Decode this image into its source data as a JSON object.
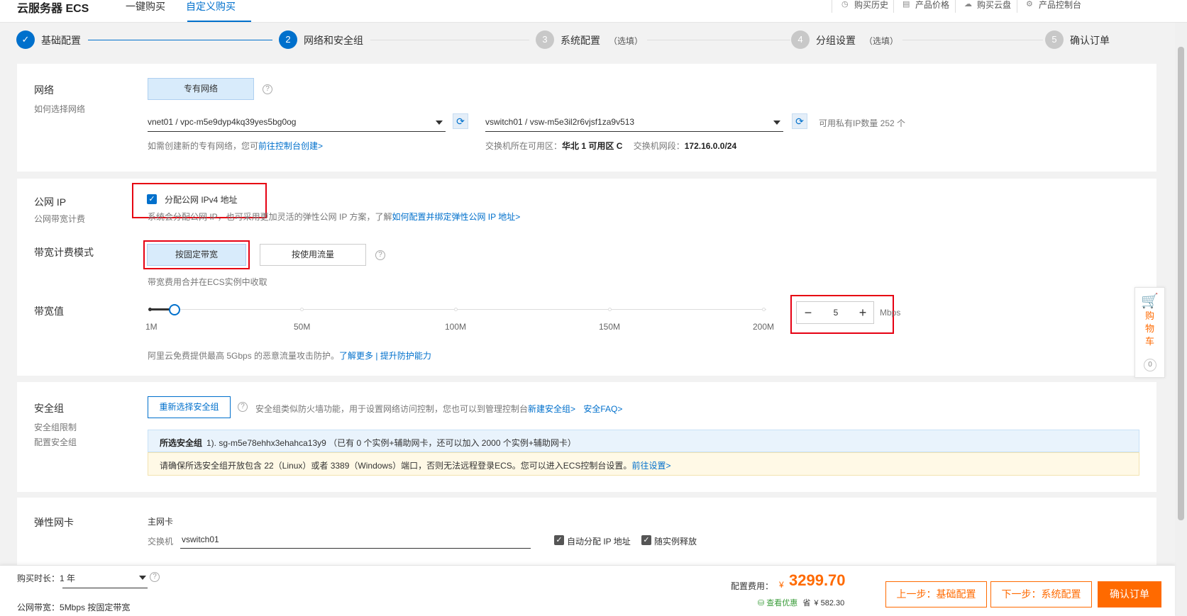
{
  "header": {
    "brand": "云服务器 ECS",
    "tabs": [
      {
        "label": "一键购买"
      },
      {
        "label": "自定义购买"
      }
    ],
    "tools": [
      {
        "label": "购买历史",
        "icon": "clock-icon"
      },
      {
        "label": "产品价格",
        "icon": "document-icon"
      },
      {
        "label": "购买云盘",
        "icon": "cloud-icon"
      },
      {
        "label": "产品控制台",
        "icon": "gear-icon"
      }
    ]
  },
  "steps": [
    {
      "num": "✓",
      "label": "基础配置",
      "optional": ""
    },
    {
      "num": "2",
      "label": "网络和安全组",
      "optional": ""
    },
    {
      "num": "3",
      "label": "系统配置",
      "optional": "（选填）"
    },
    {
      "num": "4",
      "label": "分组设置",
      "optional": "（选填）"
    },
    {
      "num": "5",
      "label": "确认订单",
      "optional": ""
    }
  ],
  "network": {
    "label": "网络",
    "sublabel": "如何选择网络",
    "vpc_button": "专有网络",
    "vpc_select": "vnet01 / vpc-m5e9dyp4kq39yes5bg0og",
    "vswitch_select": "vswitch01 / vsw-m5e3il2r6vjsf1za9v513",
    "available_ip": "可用私有IP数量 252 个",
    "create_hint": "如需创建新的专有网络，您可",
    "create_link": "前往控制台创建>",
    "zone_label": "交换机所在可用区：",
    "zone_value": "华北 1 可用区 C",
    "cidr_label": "交换机网段：",
    "cidr_value": "172.16.0.0/24"
  },
  "public_ip": {
    "label": "公网 IP",
    "sublabel": "公网带宽计费",
    "checkbox_label": "分配公网 IPv4 地址",
    "hint": "系统会分配公网 IP，也可采用更加灵活的弹性公网 IP 方案，了解",
    "hint_link": "如何配置并绑定弹性公网 IP 地址>",
    "billing_label": "带宽计费模式",
    "billing_fixed": "按固定带宽",
    "billing_traffic": "按使用流量",
    "billing_hint": "带宽费用合并在ECS实例中收取",
    "bandwidth_label": "带宽值",
    "slider_ticks": [
      "1M",
      "50M",
      "100M",
      "150M",
      "200M"
    ],
    "slider_max": 200,
    "bandwidth_value": "5",
    "bandwidth_unit": "Mbps",
    "ddos_hint": "阿里云免费提供最高 5Gbps 的恶意流量攻击防护。",
    "ddos_link1": "了解更多",
    "ddos_sep": "|",
    "ddos_link2": "提升防护能力"
  },
  "security": {
    "label": "安全组",
    "sublabel1": "安全组限制",
    "sublabel2": "配置安全组",
    "reselect_button": "重新选择安全组",
    "hint": "安全组类似防火墙功能，用于设置网络访问控制，您也可以到管理控制台",
    "link_new": "新建安全组>",
    "link_faq": "安全FAQ>",
    "selected_label": "所选安全组",
    "selected_value": "1). sg-m5e78ehhx3ehahca13y9 （已有 0 个实例+辅助网卡，还可以加入 2000 个实例+辅助网卡）",
    "warning": "请确保所选安全组开放包含 22（Linux）或者 3389（Windows）端口，否则无法远程登录ECS。您可以进入ECS控制台设置。",
    "warning_link": "前往设置>"
  },
  "eni": {
    "label": "弹性网卡",
    "primary_label": "主网卡",
    "switch_label": "交换机",
    "switch_value": "vswitch01",
    "auto_ip": "自动分配 IP 地址",
    "release": "随实例释放"
  },
  "cart": {
    "chars": [
      "购",
      "物",
      "车"
    ],
    "count": "0"
  },
  "footer": {
    "duration_label": "购买时长：",
    "duration_value": "1 年",
    "bandwidth_label": "公网带宽：",
    "bandwidth_value": "5Mbps 按固定带宽",
    "price_label": "配置费用：",
    "currency": "¥",
    "price": "3299.70",
    "discount_link": "查看优惠",
    "save_label": "省",
    "save_value": "¥ 582.30",
    "prev_button": "上一步：基础配置",
    "next_button": "下一步：系统配置",
    "confirm_button": "确认订单"
  },
  "colors": {
    "accent": "#0070cc",
    "orange": "#ff6a00",
    "highlight_red": "#e60012"
  }
}
